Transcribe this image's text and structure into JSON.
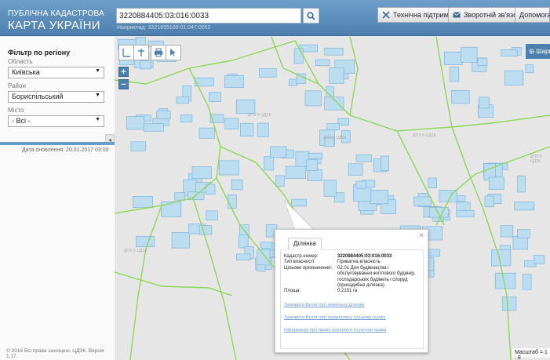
{
  "header": {
    "brand_sub": "ПУБЛІЧНА КАДАСТРОВА",
    "brand_title": "КАРТА УКРАЇНИ",
    "search_value": "3220884405:03:016:0033",
    "search_hint": "Наприклад: 3221655100:01:047:0052",
    "support_label": "Технічна підтримка",
    "feedback_label": "Зворотній зв'язок",
    "help_label": "Допомога"
  },
  "sidebar": {
    "filter_title": "Фільтр по регіону",
    "region_label": "Область",
    "region_value": "Київська",
    "district_label": "Район",
    "district_value": "Бориспільський",
    "city_label": "Місто",
    "city_value": "- Всі -",
    "update_date": "Дата оновлення: 20.01.2017 03:00",
    "copyright": "© 2016 Всі права захищені. ЦДЗК. Версія 1.17."
  },
  "map": {
    "layers_label": "Шари",
    "scale_label": "Масштаб = 1 : 8",
    "watermark": "ДПЗ © ЦДЗК"
  },
  "popup": {
    "tab_label": "Ділянка",
    "fields": [
      {
        "key": "Кадастр.номер:",
        "value": "3220884405:03:016:0033"
      },
      {
        "key": "Тип власності:",
        "value": "Приватна власність"
      },
      {
        "key": "Цільове призначення:",
        "value": "02.01 Для будівництва і обслуговування житлового будинку, господарських будівель і споруд (присадибна ділянка)"
      },
      {
        "key": "Площа:",
        "value": "0.2151 га"
      }
    ],
    "links": [
      "Замовити Витяг про земельну ділянку",
      "Замовити Витяг про нормативну грошову оцінку",
      "Інформація про право власності та речові права"
    ]
  }
}
